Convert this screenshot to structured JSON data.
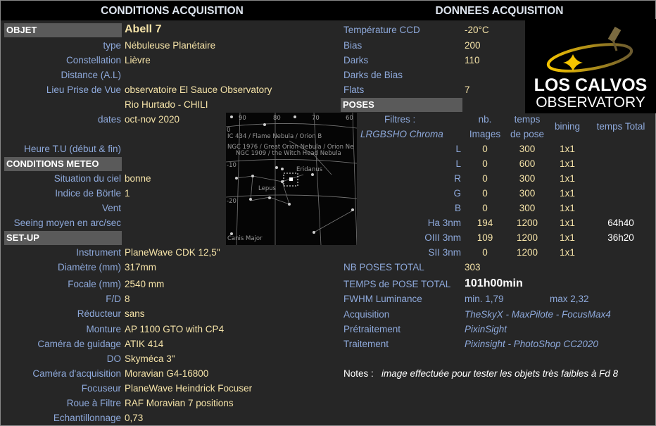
{
  "left": {
    "title": "CONDITIONS ACQUISITION",
    "objet_header": "OBJET",
    "objet_value": "Abell 7",
    "rows": [
      {
        "label": "type",
        "value": "Nébuleuse Planétaire"
      },
      {
        "label": "Constellation",
        "value": "Lièvre"
      },
      {
        "label": "Distance (A.L)",
        "value": ""
      },
      {
        "label": "Lieu Prise de Vue",
        "value": "observatoire El Sauce Observatory"
      },
      {
        "label": "",
        "value": "Rio Hurtado - CHILI"
      },
      {
        "label": "dates",
        "value": "oct-nov 2020"
      },
      {
        "label": "Heure T.U (début & fin)",
        "value": ""
      }
    ],
    "meteo_header": "CONDITIONS METEO",
    "meteo": [
      {
        "label": "Situation du ciel",
        "value": "bonne"
      },
      {
        "label": "Indice de Börtle",
        "value": "1"
      },
      {
        "label": "Vent",
        "value": ""
      },
      {
        "label": "Seeing moyen en arc/sec",
        "value": ""
      }
    ],
    "setup_header": "SET-UP",
    "setup": [
      {
        "label": "Instrument",
        "value": "PlaneWave CDK 12,5\""
      },
      {
        "label": "Diamètre (mm)",
        "value": "317mm"
      },
      {
        "label": "Focale (mm)",
        "value": "2540 mm"
      },
      {
        "label": "F/D",
        "value": "8"
      },
      {
        "label": "Réducteur",
        "value": "sans"
      },
      {
        "label": "Monture",
        "value": "AP 1100 GTO with CP4"
      },
      {
        "label": "Caméra de guidage",
        "value": "ATIK 414"
      },
      {
        "label": "DO",
        "value": "Skyméca 3\""
      },
      {
        "label": "Caméra d'acquisition",
        "value": "Moravian G4-16800"
      },
      {
        "label": "Focuseur",
        "value": "PlaneWave Heindrick Focuser"
      },
      {
        "label": "Roue à Filtre",
        "value": "RAF Moravian 7 positions"
      },
      {
        "label": "Echantillonnage",
        "value": "0,73"
      }
    ]
  },
  "star_map": {
    "labels": [
      "IC 434 / Flame Nebula / Orion B",
      "NGC 1976 / Great Orion Nebula / Orion Ne",
      "NGC 1909 / the Witch Head Nebula",
      "Eridanus",
      "Lepus",
      "Canis Major",
      "90",
      "80",
      "70",
      "60",
      "0",
      "-10",
      "-20"
    ]
  },
  "right": {
    "title": "DONNEES ACQUISITION",
    "rows": [
      {
        "label": "Température CCD",
        "value": "-20°C"
      },
      {
        "label": "Bias",
        "value": "200"
      },
      {
        "label": "Darks",
        "value": "110"
      },
      {
        "label": "Darks de Bias",
        "value": ""
      },
      {
        "label": "Flats",
        "value": "7"
      }
    ],
    "poses_header": "POSES",
    "filters_label": "Filtres :",
    "filters_name": "LRGBSHO Chroma",
    "col_nb_1": "nb.",
    "col_nb_2": "Images",
    "col_temps_1": "temps",
    "col_temps_2": "de pose",
    "col_bining": "bining",
    "col_total": "temps Total",
    "poses": [
      {
        "filter": "L",
        "nb": "0",
        "temps": "300",
        "bining": "1x1",
        "total": ""
      },
      {
        "filter": "L",
        "nb": "0",
        "temps": "600",
        "bining": "1x1",
        "total": ""
      },
      {
        "filter": "R",
        "nb": "0",
        "temps": "300",
        "bining": "1x1",
        "total": ""
      },
      {
        "filter": "G",
        "nb": "0",
        "temps": "300",
        "bining": "1x1",
        "total": ""
      },
      {
        "filter": "B",
        "nb": "0",
        "temps": "300",
        "bining": "1x1",
        "total": ""
      },
      {
        "filter": "Ha 3nm",
        "nb": "194",
        "temps": "1200",
        "bining": "1x1",
        "total": "64h40"
      },
      {
        "filter": "OIII 3nm",
        "nb": "109",
        "temps": "1200",
        "bining": "1x1",
        "total": "36h20"
      },
      {
        "filter": "SII 3nm",
        "nb": "0",
        "temps": "1200",
        "bining": "1x1",
        "total": ""
      }
    ],
    "nb_poses_label": "NB POSES TOTAL",
    "nb_poses_value": "303",
    "temps_total_label": "TEMPS de POSE TOTAL",
    "temps_total_value": "101h00min",
    "fwhm_label": "FWHM Luminance",
    "fwhm_min": "min. 1,79",
    "fwhm_max": "max 2,32",
    "software": [
      {
        "label": "Acquisition",
        "value": "TheSkyX - MaxPilote - FocusMax4"
      },
      {
        "label": "Prétraitement",
        "value": "PixinSight"
      },
      {
        "label": "Traitement",
        "value": "Pixinsight - PhotoShop CC2020"
      }
    ],
    "notes_label": "Notes :",
    "notes_value": "image effectuée pour tester les objets très faibles à Fd 8"
  },
  "logo": {
    "line1": "LOS CALVOS",
    "line2": "OBSERVATORY",
    "gold": "#e8b400"
  },
  "colors": {
    "background": "#262626",
    "label": "#8ea9db",
    "value": "#f5e3a8",
    "header_bar": "#5a5a5a"
  }
}
